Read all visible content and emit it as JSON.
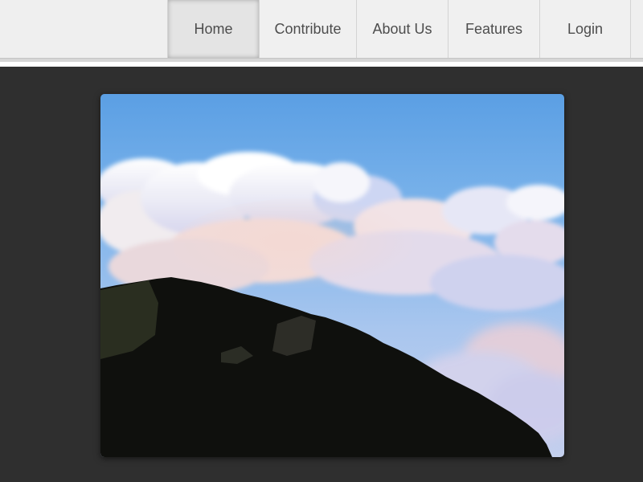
{
  "nav": {
    "items": [
      {
        "label": "Home",
        "active": true
      },
      {
        "label": "Contribute",
        "active": false
      },
      {
        "label": "About Us",
        "active": false
      },
      {
        "label": "Features",
        "active": false
      },
      {
        "label": "Login",
        "active": false
      }
    ]
  },
  "colors": {
    "topbar_bg": "#efefef",
    "page_bg": "#2f2f2f",
    "sky_top": "#5a9fe3",
    "cloud": "#f3f1f2",
    "mountain": "#0e0f0c"
  }
}
